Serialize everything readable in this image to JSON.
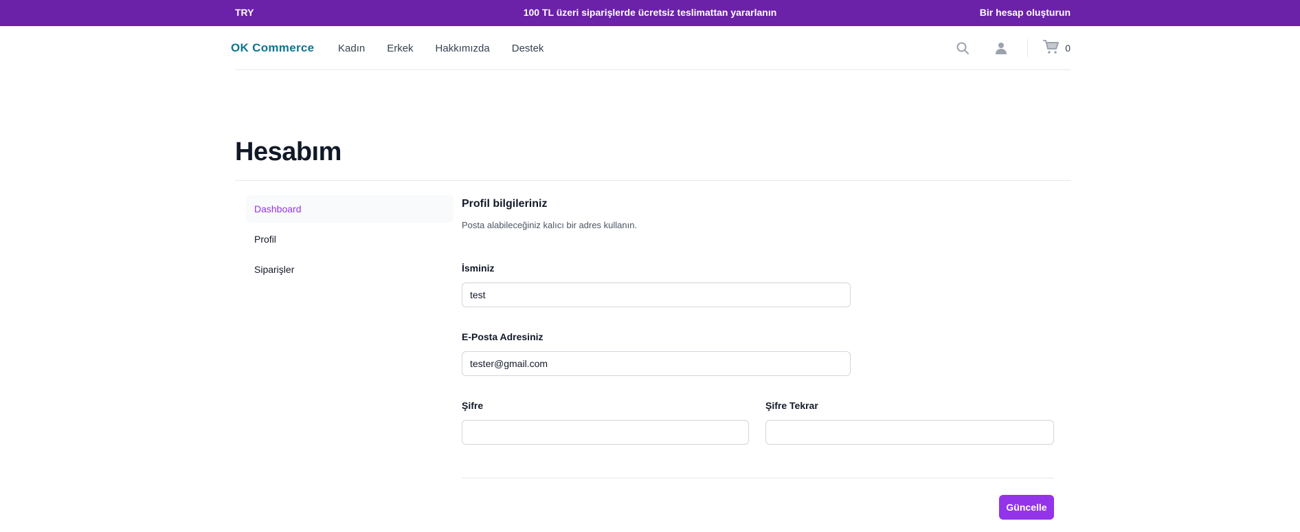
{
  "promo": {
    "currency": "TRY",
    "message": "100 TL üzeri siparişlerde ücretsiz teslimattan yararlanın",
    "account_link": "Bir hesap oluşturun",
    "background": "#6b21a8"
  },
  "header": {
    "logo": "OK Commerce",
    "nav": [
      "Kadın",
      "Erkek",
      "Hakkımızda",
      "Destek"
    ],
    "icons": [
      "search-icon",
      "user-icon",
      "cart-icon"
    ],
    "cart_count": "0"
  },
  "page": {
    "title": "Hesabım"
  },
  "sidebar": {
    "items": [
      {
        "label": "Dashboard",
        "active": true
      },
      {
        "label": "Profil",
        "active": false
      },
      {
        "label": "Siparişler",
        "active": false
      }
    ]
  },
  "profile_form": {
    "title": "Profil bilgileriniz",
    "subtitle": "Posta alabileceğiniz kalıcı bir adres kullanın.",
    "name_label": "İsminiz",
    "name_value": "test",
    "email_label": "E-Posta Adresiniz",
    "email_value": "tester@gmail.com",
    "password_label": "Şifre",
    "password_value": "",
    "password_repeat_label": "Şifre Tekrar",
    "password_repeat_value": "",
    "submit_label": "Güncelle"
  },
  "colors": {
    "accent": "#9333ea",
    "logo": "#0e7490"
  }
}
